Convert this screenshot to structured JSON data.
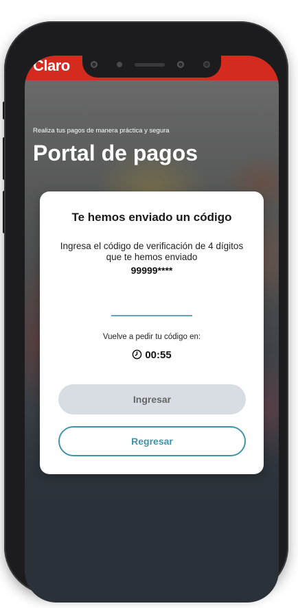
{
  "brand": {
    "logo_text": "Claro",
    "accent_color": "#d52b1e"
  },
  "header": {
    "subtitle": "Realiza tus pagos de manera práctica y segura",
    "title": "Portal de pagos"
  },
  "modal": {
    "title": "Te hemos enviado un código",
    "description": "Ingresa el código de verificación de 4 dígitos que te hemos enviado",
    "masked_phone": "99999****",
    "code_input": {
      "value": "",
      "placeholder": ""
    },
    "resend_text": "Vuelve a pedir tu código en:",
    "timer": "00:55",
    "timer_icon": "clock-icon",
    "primary_button": {
      "label": "Ingresar",
      "state": "disabled",
      "color": "#d8dde3"
    },
    "secondary_button": {
      "label": "Regresar",
      "color": "#3e95a9"
    }
  }
}
